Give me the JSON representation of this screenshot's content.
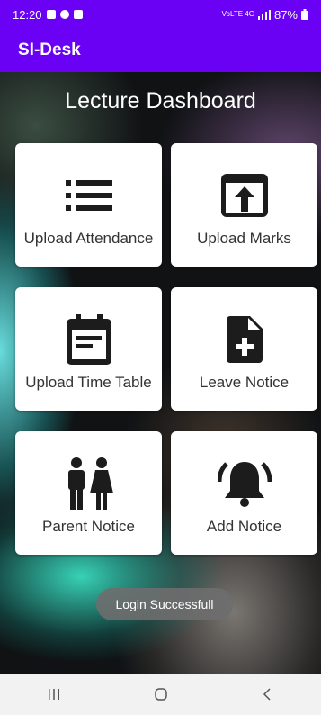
{
  "status_bar": {
    "time": "12:20",
    "network": "VoLTE 4G",
    "battery": "87%"
  },
  "app_bar": {
    "title": "SI-Desk"
  },
  "dashboard": {
    "title": "Lecture Dashboard",
    "cards": [
      {
        "label": "Upload Attendance",
        "icon": "list-icon"
      },
      {
        "label": "Upload Marks",
        "icon": "upload-icon"
      },
      {
        "label": "Upload Time Table",
        "icon": "calendar-icon"
      },
      {
        "label": "Leave Notice",
        "icon": "note-add-icon"
      },
      {
        "label": "Parent Notice",
        "icon": "parents-icon"
      },
      {
        "label": "Add Notice",
        "icon": "bell-ring-icon"
      }
    ]
  },
  "toast": {
    "message": "Login Successfull"
  },
  "nav": {
    "recents": "|||",
    "home": "○",
    "back": "<"
  },
  "colors": {
    "primary": "#6a00f4",
    "card": "#ffffff",
    "icon": "#1c1c1c"
  }
}
